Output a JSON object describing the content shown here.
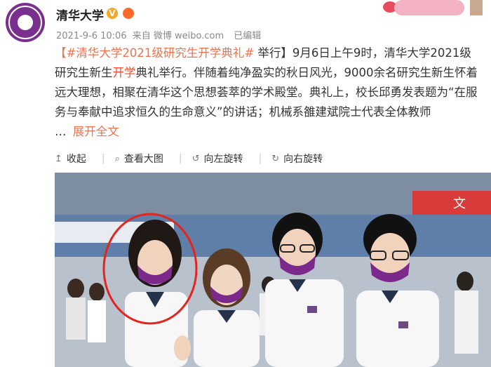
{
  "header": {
    "username": "清华大学",
    "meta": {
      "date": "2021-9-6 10:06",
      "source": "来自 微博 weibo.com",
      "edited": "已编辑"
    }
  },
  "post": {
    "hashtag_open": "【#清华大学2021级研究生开学典礼#",
    "text_part1": " 举行】9月6日上午9时，清华大学2021级研究生新生",
    "highlight": "开学",
    "text_part2": "典礼举行。伴随着纯净盈实的秋日风光，9000余名研究生新生怀着远大理想，相聚在清华这个思想荟萃的学术殿堂。典礼上，校长邱勇发表题为“在服务与奉献中追求恒久的生命意义”的讲话；机械系雒建斌院士代表全体教师",
    "ellipsis": "…",
    "expand_label": "展开全文"
  },
  "toolbar": {
    "collapse_label": "收起",
    "view_large_label": "查看大图",
    "rotate_left_label": "向左旋转",
    "rotate_right_label": "向右旋转"
  },
  "photo": {
    "banner_text": "文"
  },
  "colors": {
    "link": "#eb7350",
    "highlight": "#ff4b2b",
    "mask": "#7b2a8c",
    "circle": "#e3251f"
  }
}
